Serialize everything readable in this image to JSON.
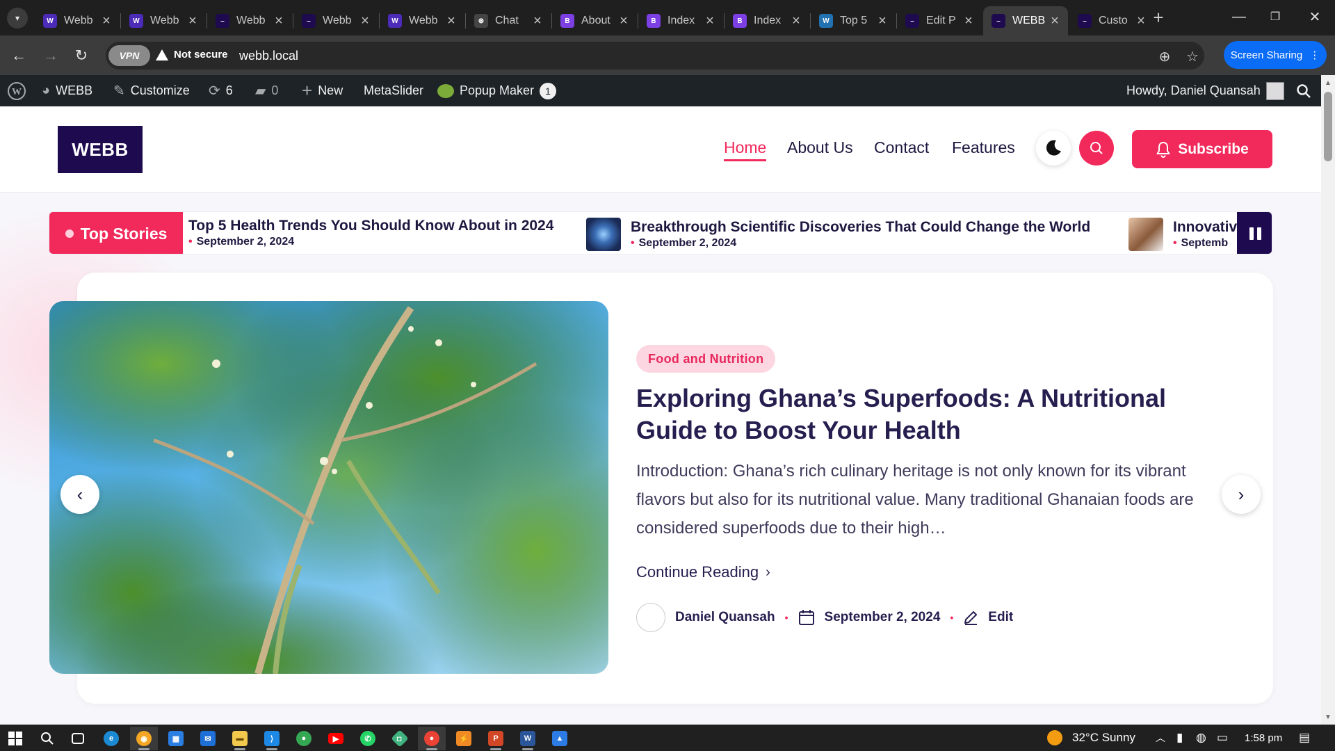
{
  "browser": {
    "tabs": [
      {
        "label": "Webb",
        "fav": "W",
        "color": "#4b2bb8"
      },
      {
        "label": "Webb",
        "fav": "W",
        "color": "#4b2bb8"
      },
      {
        "label": "Webb",
        "fav": "–",
        "color": "#1e0a4f"
      },
      {
        "label": "Webb",
        "fav": "–",
        "color": "#1e0a4f"
      },
      {
        "label": "Webb",
        "fav": "W",
        "color": "#4b2bb8"
      },
      {
        "label": "Chat",
        "fav": "⊛",
        "color": "#444444"
      },
      {
        "label": "About",
        "fav": "B",
        "color": "#7b3fe4"
      },
      {
        "label": "Index",
        "fav": "B",
        "color": "#7b3fe4"
      },
      {
        "label": "Index",
        "fav": "B",
        "color": "#7b3fe4"
      },
      {
        "label": "Top 5",
        "fav": "W",
        "color": "#2271b1"
      },
      {
        "label": "Edit P",
        "fav": "–",
        "color": "#1e0a4f"
      },
      {
        "label": "WEBB",
        "fav": "–",
        "color": "#1e0a4f",
        "active": true
      },
      {
        "label": "Custo",
        "fav": "–",
        "color": "#1e0a4f"
      }
    ],
    "security_label": "Not secure",
    "vpn_label": "VPN",
    "url": "webb.local",
    "screen_sharing_label": "Screen Sharing"
  },
  "adminbar": {
    "site_name": "WEBB",
    "customize": "Customize",
    "updates_count": "6",
    "comments_count": "0",
    "new_label": "New",
    "metaslider": "MetaSlider",
    "popup_maker": "Popup Maker",
    "popup_badge": "1",
    "howdy": "Howdy, Daniel Quansah"
  },
  "site": {
    "logo": "WEBB",
    "nav": [
      "Home",
      "About Us",
      "Contact",
      "Features"
    ],
    "subscribe": "Subscribe"
  },
  "ticker": {
    "label": "Top Stories",
    "items": [
      {
        "title": "Top 5 Health Trends You Should Know About in 2024",
        "date": "September 2, 2024"
      },
      {
        "title": "Breakthrough Scientific Discoveries That Could Change the World",
        "date": "September 2, 2024"
      },
      {
        "title": "Innovativ",
        "date": "Septemb"
      }
    ]
  },
  "post": {
    "category": "Food and Nutrition",
    "title": "Exploring Ghana’s Superfoods: A Nutritional Guide to Boost Your Health",
    "excerpt": "Introduction: Ghana’s rich culinary heritage is not only known for its vibrant flavors but also for its nutritional value. Many traditional Ghanaian foods are considered superfoods due to their high…",
    "read_more": "Continue Reading",
    "author": "Daniel Quansah",
    "date": "September 2, 2024",
    "edit": "Edit"
  },
  "taskbar": {
    "weather": "32°C  Sunny",
    "time": "1:58 pm"
  }
}
